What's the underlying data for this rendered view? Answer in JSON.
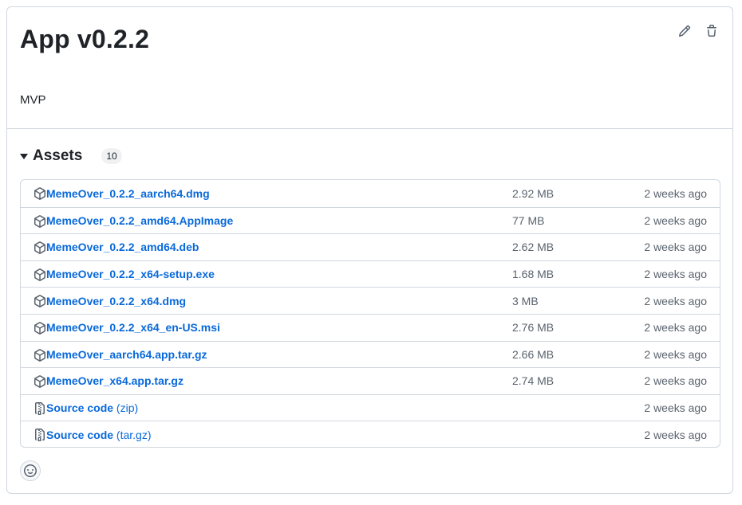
{
  "release": {
    "title": "App v0.2.2",
    "body": "MVP"
  },
  "actions": {
    "edit_icon": "pencil-icon",
    "delete_icon": "trash-icon"
  },
  "assets": {
    "title": "Assets",
    "count": "10",
    "items": [
      {
        "name": "MemeOver_0.2.2_aarch64.dmg",
        "suffix": "",
        "size": "2.92 MB",
        "date": "2 weeks ago",
        "icon": "package-icon"
      },
      {
        "name": "MemeOver_0.2.2_amd64.AppImage",
        "suffix": "",
        "size": "77 MB",
        "date": "2 weeks ago",
        "icon": "package-icon"
      },
      {
        "name": "MemeOver_0.2.2_amd64.deb",
        "suffix": "",
        "size": "2.62 MB",
        "date": "2 weeks ago",
        "icon": "package-icon"
      },
      {
        "name": "MemeOver_0.2.2_x64-setup.exe",
        "suffix": "",
        "size": "1.68 MB",
        "date": "2 weeks ago",
        "icon": "package-icon"
      },
      {
        "name": "MemeOver_0.2.2_x64.dmg",
        "suffix": "",
        "size": "3 MB",
        "date": "2 weeks ago",
        "icon": "package-icon"
      },
      {
        "name": "MemeOver_0.2.2_x64_en-US.msi",
        "suffix": "",
        "size": "2.76 MB",
        "date": "2 weeks ago",
        "icon": "package-icon"
      },
      {
        "name": "MemeOver_aarch64.app.tar.gz",
        "suffix": "",
        "size": "2.66 MB",
        "date": "2 weeks ago",
        "icon": "package-icon"
      },
      {
        "name": "MemeOver_x64.app.tar.gz",
        "suffix": "",
        "size": "2.74 MB",
        "date": "2 weeks ago",
        "icon": "package-icon"
      },
      {
        "name": "Source code",
        "suffix": " (zip)",
        "size": "",
        "date": "2 weeks ago",
        "icon": "file-zip-icon"
      },
      {
        "name": "Source code",
        "suffix": " (tar.gz)",
        "size": "",
        "date": "2 weeks ago",
        "icon": "file-zip-icon"
      }
    ]
  },
  "reactions": {
    "icon": "smiley-icon"
  },
  "colors": {
    "link": "#0969da",
    "muted": "#59636e",
    "border": "#d0d7de"
  }
}
